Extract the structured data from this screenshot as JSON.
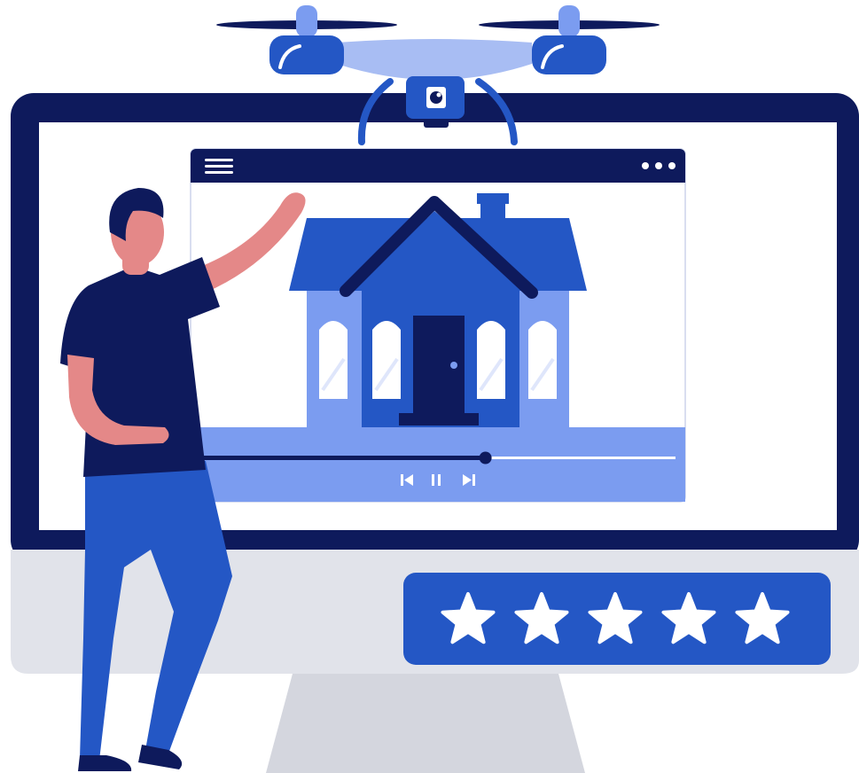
{
  "illustration": {
    "subject": "drone-real-estate-video-tour",
    "icons": {
      "menu": "hamburger-menu-icon",
      "more": "more-dots-icon",
      "prev": "skip-previous-icon",
      "pause": "pause-icon",
      "next": "skip-next-icon",
      "star": "star-icon"
    },
    "player": {
      "progress": 0.6,
      "state": "playing"
    },
    "rating": {
      "stars_filled": 5,
      "stars_total": 5
    },
    "colors": {
      "navy": "#0e1a5c",
      "blue": "#2457c5",
      "light_blue": "#7b9cf0",
      "pale_blue": "#a8bdf3",
      "skin": "#e48888",
      "gray": "#e1e3ea",
      "stand": "#d4d6de",
      "white": "#ffffff"
    }
  }
}
